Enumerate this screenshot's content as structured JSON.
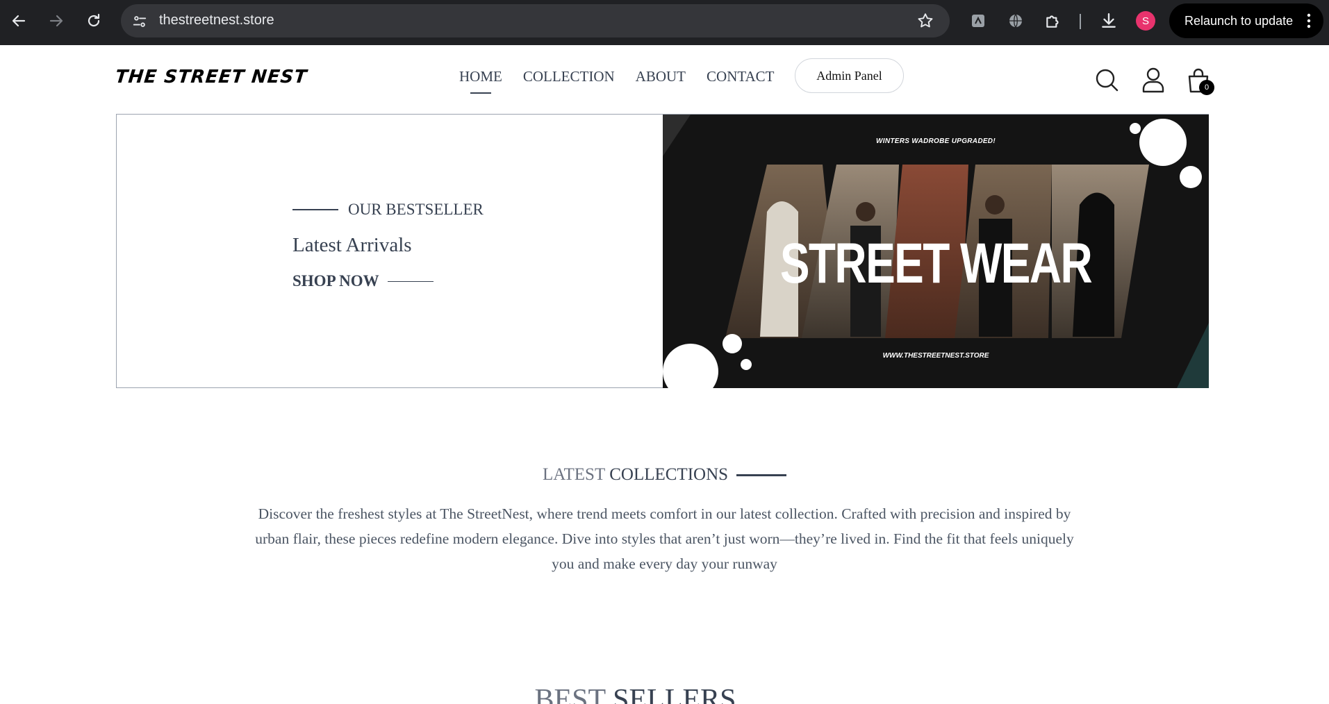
{
  "browser": {
    "url": "thestreetnest.store",
    "relaunch_label": "Relaunch to update",
    "profile_initial": "S"
  },
  "site": {
    "logo": "THE STREET NEST",
    "nav": [
      "HOME",
      "COLLECTION",
      "ABOUT",
      "CONTACT"
    ],
    "active_nav": "HOME",
    "admin_label": "Admin Panel",
    "cart_count": "0"
  },
  "hero": {
    "eyebrow": "OUR BESTSELLER",
    "heading": "Latest Arrivals",
    "cta": "SHOP NOW",
    "banner": {
      "top_text": "WINTERS WADROBE UPGRADED!",
      "big_text": "STREET WEAR",
      "bottom_text": "WWW.THESTREETNEST.STORE"
    }
  },
  "latest": {
    "title_light": "LATEST",
    "title_dark": "COLLECTIONS",
    "description": "Discover the freshest styles at The StreetNest, where trend meets comfort in our latest collection. Crafted with precision and inspired by urban flair, these pieces redefine modern elegance. Dive into styles that aren’t just worn—they’re lived in. Find the fit that feels uniquely you and make every day your runway"
  },
  "bestsellers": {
    "title_light": "BEST",
    "title_dark": "SELLERS"
  },
  "colors": {
    "chrome_bg": "#202124",
    "omnibox_bg": "#35363a",
    "text_primary": "#374151",
    "text_muted": "#6b7280",
    "profile_bg": "#e8336d"
  }
}
